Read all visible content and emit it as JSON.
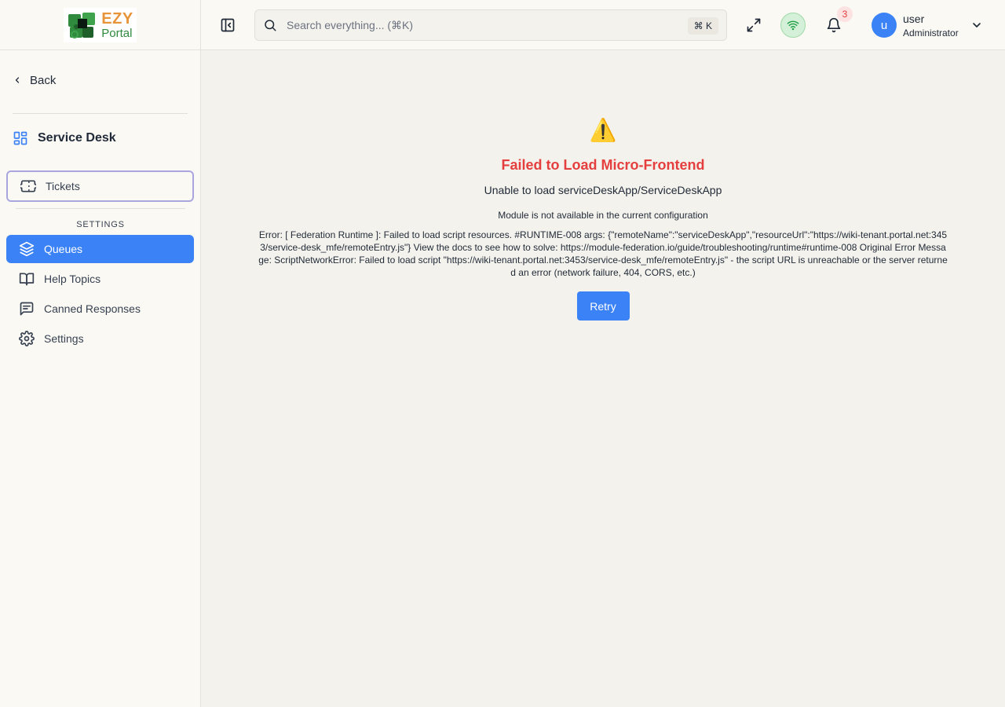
{
  "brand": {
    "logo_top": "EZY",
    "logo_bottom": "Portal"
  },
  "sidebar": {
    "back_label": "Back",
    "section_title": "Service Desk",
    "tickets_label": "Tickets",
    "settings_heading": "SETTINGS",
    "items": [
      {
        "label": "Queues",
        "icon": "layers-icon",
        "active": true
      },
      {
        "label": "Help Topics",
        "icon": "book-open-icon",
        "active": false
      },
      {
        "label": "Canned Responses",
        "icon": "message-square-text-icon",
        "active": false
      },
      {
        "label": "Settings",
        "icon": "gear-icon",
        "active": false
      }
    ]
  },
  "header": {
    "search_placeholder": "Search everything... (⌘K)",
    "search_shortcut": "⌘ K",
    "notification_count": "3",
    "user_initial": "u",
    "user_name": "user",
    "user_role": "Administrator"
  },
  "error": {
    "icon": "⚠️",
    "title": "Failed to Load Micro-Frontend",
    "subtitle": "Unable to load serviceDeskApp/ServiceDeskApp",
    "module_message": "Module is not available in the current configuration",
    "detail": "Error: [ Federation Runtime ]: Failed to load script resources. #RUNTIME-008 args: {\"remoteName\":\"serviceDeskApp\",\"resourceUrl\":\"https://wiki-tenant.portal.net:3453/service-desk_mfe/remoteEntry.js\"} View the docs to see how to solve: https://module-federation.io/guide/troubleshooting/runtime#runtime-008 Original Error Message: ScriptNetworkError: Failed to load script \"https://wiki-tenant.portal.net:3453/service-desk_mfe/remoteEntry.js\" - the script URL is unreachable or the server returned an error (network failure, 404, CORS, etc.)",
    "retry_label": "Retry"
  },
  "colors": {
    "accent": "#3b82f6",
    "error": "#e53e3e",
    "brand_orange": "#e8943a",
    "brand_green": "#2f8a3e"
  }
}
